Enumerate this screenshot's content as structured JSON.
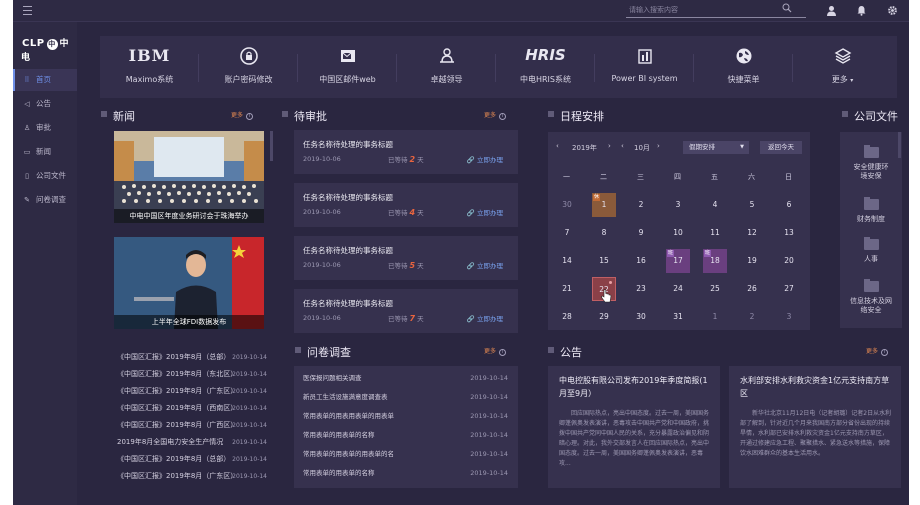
{
  "topbar": {
    "search_placeholder": "请输入搜索内容"
  },
  "sidebar": {
    "logo_left": "CLP",
    "logo_mid": "中",
    "logo_right": "中电",
    "items": [
      {
        "label": "首页",
        "icon": "grid-icon",
        "glyph": "⠿",
        "active": true
      },
      {
        "label": "公告",
        "icon": "megaphone-icon",
        "glyph": "◁",
        "active": false
      },
      {
        "label": "审批",
        "icon": "user-icon",
        "glyph": "♙",
        "active": false
      },
      {
        "label": "新闻",
        "icon": "news-icon",
        "glyph": "▭",
        "active": false
      },
      {
        "label": "公司文件",
        "icon": "file-icon",
        "glyph": "▯",
        "active": false
      },
      {
        "label": "问卷调查",
        "icon": "edit-icon",
        "glyph": "✎",
        "active": false
      }
    ]
  },
  "apps": [
    {
      "label": "Maximo系统",
      "icon": "ibm-logo",
      "glyph": "IBM"
    },
    {
      "label": "账户密码修改",
      "icon": "lock-icon",
      "glyph": "🔒"
    },
    {
      "label": "中国区邮件web",
      "icon": "mail-icon",
      "glyph": "✉"
    },
    {
      "label": "卓越领导",
      "icon": "leader-icon",
      "glyph": "♔"
    },
    {
      "label": "中电HRIS系统",
      "icon": "hris-logo",
      "glyph": "HRIS"
    },
    {
      "label": "Power BI system",
      "icon": "chart-icon",
      "glyph": "▥"
    },
    {
      "label": "快捷菜单",
      "icon": "globe-icon",
      "glyph": "◍"
    },
    {
      "label": "更多",
      "icon": "layers-icon",
      "glyph": "◈",
      "dropdown": "▾"
    }
  ],
  "news": {
    "title": "新闻",
    "more": "更多",
    "images": [
      {
        "caption": "中电中国区年度业务研讨会于珠海举办"
      },
      {
        "caption": "上半年全球FDI数据发布"
      }
    ],
    "list": [
      {
        "title": "《中国区汇报》2019年8月（总部）",
        "date": "2019-10-14"
      },
      {
        "title": "《中国区汇报》2019年8月（东北区）",
        "date": "2019-10-14"
      },
      {
        "title": "《中国区汇报》2019年8月（广东区）",
        "date": "2019-10-14"
      },
      {
        "title": "《中国区汇报》2019年8月（西南区）",
        "date": "2019-10-14"
      },
      {
        "title": "《中国区汇报》2019年8月（广西区）",
        "date": "2019-10-14"
      },
      {
        "title": "2019年8月全国电力安全生产情况",
        "date": "2019-10-14"
      },
      {
        "title": "《中国区汇报》2019年8月（总部）",
        "date": "2019-10-14"
      },
      {
        "title": "《中国区汇报》2019年8月（广东区）",
        "date": "2019-10-14"
      }
    ]
  },
  "approvals": {
    "title": "待审批",
    "more": "更多",
    "items": [
      {
        "title": "任务名称待处理的事务标题",
        "date": "2019-10-06",
        "wait_pre": "已等待",
        "days": "2",
        "wait_post": "天",
        "action": "立即办理"
      },
      {
        "title": "任务名称待处理的事务标题",
        "date": "2019-10-06",
        "wait_pre": "已等待",
        "days": "4",
        "wait_post": "天",
        "action": "立即办理"
      },
      {
        "title": "任务名称待处理的事务标题",
        "date": "2019-10-06",
        "wait_pre": "已等待",
        "days": "5",
        "wait_post": "天",
        "action": "立即办理"
      },
      {
        "title": "任务名称待处理的事务标题",
        "date": "2019-10-06",
        "wait_pre": "已等待",
        "days": "7",
        "wait_post": "天",
        "action": "立即办理"
      }
    ]
  },
  "survey": {
    "title": "问卷调查",
    "more": "更多",
    "items": [
      {
        "title": "医保报问题相关调查",
        "date": "2019-10-14"
      },
      {
        "title": "新员工生活设施满意度调查表",
        "date": "2019-10-14"
      },
      {
        "title": "常用表单的用表用表单的用表单",
        "date": "2019-10-14"
      },
      {
        "title": "常用表单的用表单的名称",
        "date": "2019-10-14"
      },
      {
        "title": "常用表单的用表单的用表单的名",
        "date": "2019-10-14"
      },
      {
        "title": "常用表单的用表单的名称",
        "date": "2019-10-14"
      }
    ]
  },
  "schedule": {
    "title": "日程安排",
    "prev": "‹",
    "next": "›",
    "year": "2019年",
    "month": "10月",
    "type_select": "假期安排",
    "today_btn": "返回今天",
    "weekdays": [
      "一",
      "二",
      "三",
      "四",
      "五",
      "六",
      "日"
    ],
    "days": [
      [
        "30",
        "1",
        "2",
        "3",
        "4",
        "5",
        "6"
      ],
      [
        "7",
        "8",
        "9",
        "10",
        "11",
        "12",
        "13"
      ],
      [
        "14",
        "15",
        "16",
        "17",
        "18",
        "19",
        "20"
      ],
      [
        "21",
        "22",
        "23",
        "24",
        "25",
        "26",
        "27"
      ],
      [
        "28",
        "29",
        "30",
        "31",
        "1",
        "2",
        "3"
      ]
    ],
    "tag_holiday": "休",
    "tag_work": "班"
  },
  "announcements": {
    "title": "公告",
    "more": "更多",
    "items": [
      {
        "title": "中电控股有限公司发布2019年季度简报(1月至9月）",
        "body": "回应国际热点，亮出中国态度。过去一周，美国国务卿蓬佩奥发表演讲，恶毒攻击中国共产党和中国政府，挑拨中国共产党同中国人民的关系，充分暴露政治偏见和阴暗心理。对此，我外交部发言人在回应国际热点，亮出中国态度。过去一周，美国国务卿蓬佩奥发表演讲，恶毒攻..."
      },
      {
        "title": "水利部安排水利救灾资金1亿元支持南方草区",
        "body": "新华社北京11月12日电（记者胡璐）记者2日从水利部了解到，针对近几个月来我国南方部分省份出现的持续旱情，水利部已安排水利救灾资金1亿元支持南方草区，开通过修建应急工程、聚聚措水、紧急送水等措施，保障饮水困难群众的基本生活用水。"
      }
    ]
  },
  "files": {
    "title": "公司文件",
    "items": [
      {
        "label": "安全健康环境安保"
      },
      {
        "label": "财务制度"
      },
      {
        "label": "人事"
      },
      {
        "label": "信息技术及网络安全"
      }
    ]
  },
  "colors": {
    "bg": "#2a2640",
    "panel": "#36314e",
    "accent": "#6f8fe8",
    "warn": "#e8643f",
    "more": "#e58a52"
  }
}
